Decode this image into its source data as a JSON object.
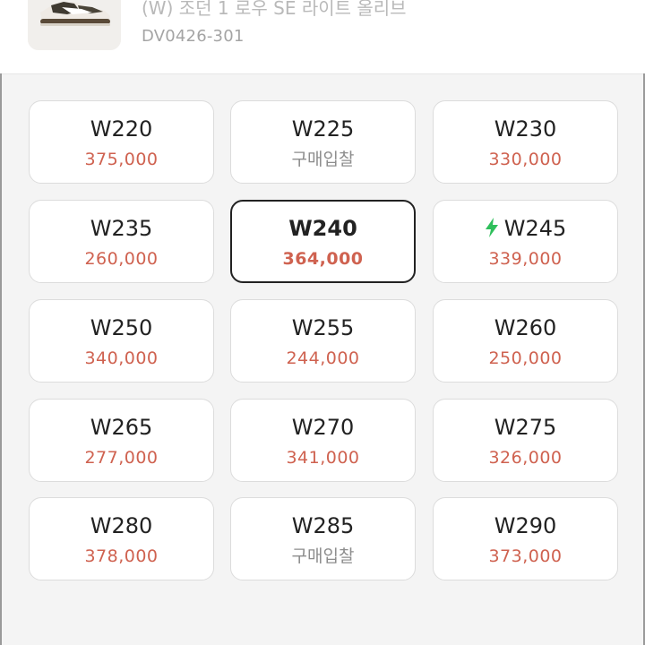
{
  "product": {
    "name": "(W) 조던 1 로우 SE 라이트 올리브",
    "code": "DV0426-301"
  },
  "colors": {
    "price": "#cf6250",
    "bid": "#8d8d8d",
    "bolt": "#2fbf5b",
    "selected_border": "#222222"
  },
  "sizes": [
    {
      "size": "W220",
      "price": "375,000"
    },
    {
      "size": "W225",
      "price": "구매입찰"
    },
    {
      "size": "W230",
      "price": "330,000"
    },
    {
      "size": "W235",
      "price": "260,000"
    },
    {
      "size": "W240",
      "price": "364,000",
      "selected": true
    },
    {
      "size": "W245",
      "price": "339,000",
      "icon": "lightning-bolt-icon"
    },
    {
      "size": "W250",
      "price": "340,000"
    },
    {
      "size": "W255",
      "price": "244,000"
    },
    {
      "size": "W260",
      "price": "250,000"
    },
    {
      "size": "W265",
      "price": "277,000"
    },
    {
      "size": "W270",
      "price": "341,000"
    },
    {
      "size": "W275",
      "price": "326,000"
    },
    {
      "size": "W280",
      "price": "378,000"
    },
    {
      "size": "W285",
      "price": "구매입찰"
    },
    {
      "size": "W290",
      "price": "373,000"
    }
  ]
}
